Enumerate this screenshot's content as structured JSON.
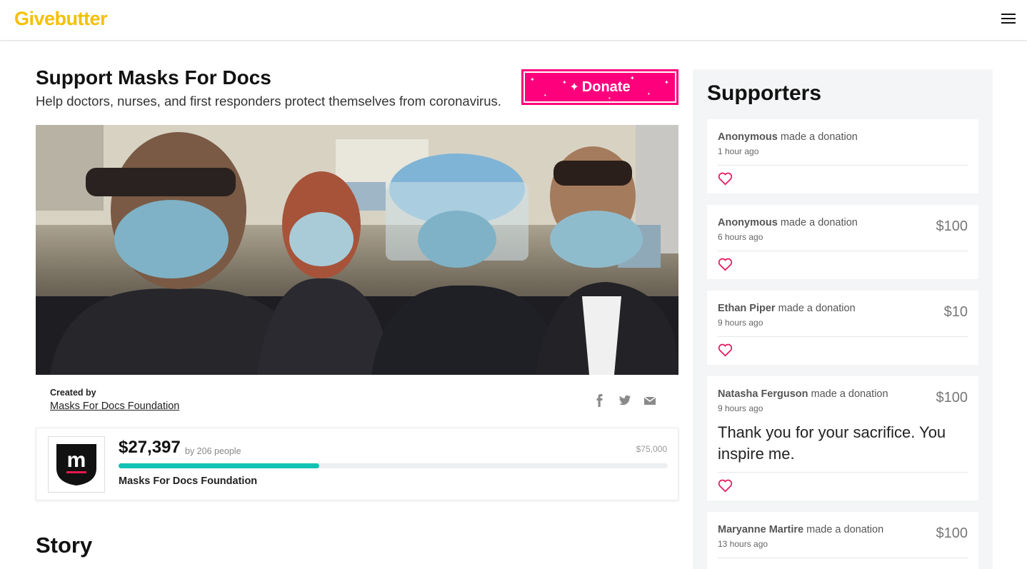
{
  "header": {
    "logo": "Givebutter",
    "menu_icon": "hamburger-menu-icon"
  },
  "campaign": {
    "title": "Support Masks For Docs",
    "subtitle": "Help doctors, nurses, and first responders protect themselves from coronavirus.",
    "donate_label": "Donate",
    "donate_color": "#ff007d",
    "created_by_label": "Created by",
    "creator": "Masks For Docs Foundation",
    "share_icons": [
      "facebook-icon",
      "twitter-icon",
      "email-icon"
    ]
  },
  "fundraiser": {
    "raised": "$27,397",
    "by_people": "by 206 people",
    "goal": "$75,000",
    "progress_fraction": 0.365,
    "org_name": "Masks For Docs Foundation",
    "progress_color": "#12c2b4"
  },
  "story_heading": "Story",
  "supporters": {
    "title": "Supporters",
    "verb": "made a donation",
    "items": [
      {
        "name": "Anonymous",
        "time": "1 hour ago",
        "amount": "",
        "message": ""
      },
      {
        "name": "Anonymous",
        "time": "6 hours ago",
        "amount": "$100",
        "message": ""
      },
      {
        "name": "Ethan Piper",
        "time": "9 hours ago",
        "amount": "$10",
        "message": ""
      },
      {
        "name": "Natasha Ferguson",
        "time": "9 hours ago",
        "amount": "$100",
        "message": "Thank you for your sacrifice. You inspire me."
      },
      {
        "name": "Maryanne Martire",
        "time": "13 hours ago",
        "amount": "$100",
        "message": ""
      }
    ]
  }
}
